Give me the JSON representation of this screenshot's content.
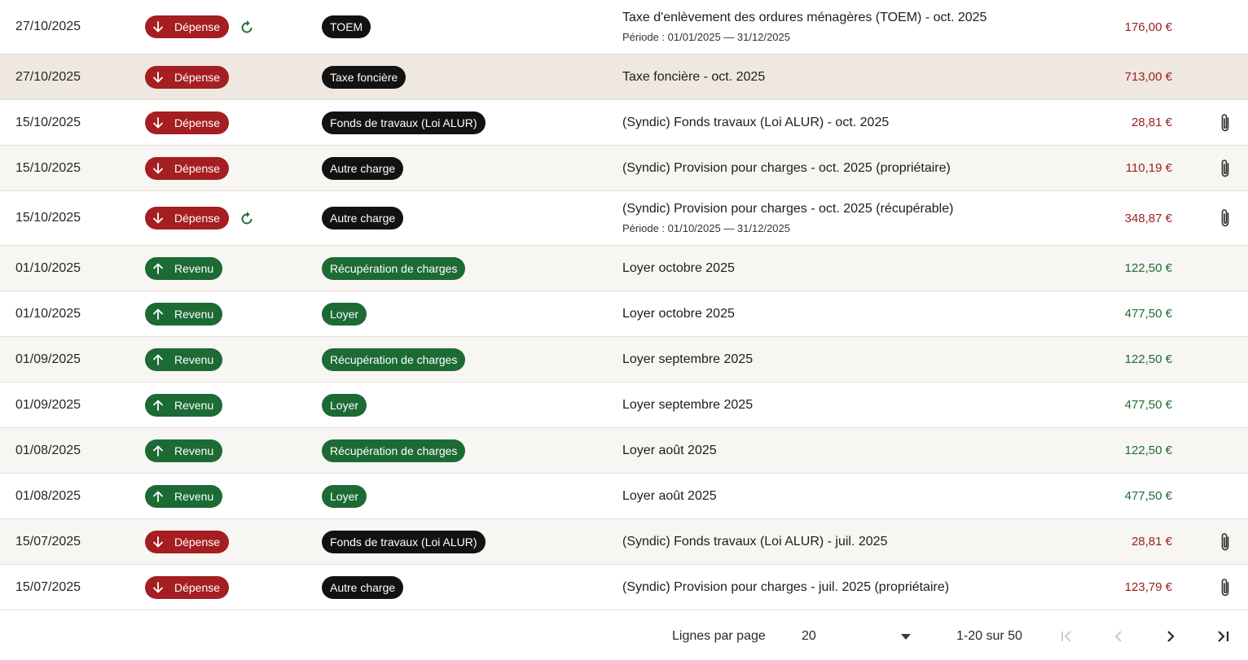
{
  "rows": [
    {
      "date": "27/10/2025",
      "type": "Dépense",
      "recurring": true,
      "category": "TOEM",
      "desc": "Taxe d'enlèvement des ordures ménagères (TOEM) - oct. 2025",
      "period": "Période : 01/01/2025 — 31/12/2025",
      "amount": "176,00 €",
      "attachment": false
    },
    {
      "date": "27/10/2025",
      "type": "Dépense",
      "recurring": false,
      "category": "Taxe foncière",
      "desc": "Taxe foncière - oct. 2025",
      "period": "",
      "amount": "713,00 €",
      "attachment": false
    },
    {
      "date": "15/10/2025",
      "type": "Dépense",
      "recurring": false,
      "category": "Fonds de travaux (Loi ALUR)",
      "desc": "(Syndic) Fonds travaux (Loi ALUR) - oct. 2025",
      "period": "",
      "amount": "28,81 €",
      "attachment": true
    },
    {
      "date": "15/10/2025",
      "type": "Dépense",
      "recurring": false,
      "category": "Autre charge",
      "desc": "(Syndic) Provision pour charges - oct. 2025 (propriétaire)",
      "period": "",
      "amount": "110,19 €",
      "attachment": true
    },
    {
      "date": "15/10/2025",
      "type": "Dépense",
      "recurring": true,
      "category": "Autre charge",
      "desc": "(Syndic) Provision pour charges - oct. 2025 (récupérable)",
      "period": "Période : 01/10/2025 — 31/12/2025",
      "amount": "348,87 €",
      "attachment": true
    },
    {
      "date": "01/10/2025",
      "type": "Revenu",
      "recurring": false,
      "category": "Récupération de charges",
      "desc": "Loyer octobre 2025",
      "period": "",
      "amount": "122,50 €",
      "attachment": false
    },
    {
      "date": "01/10/2025",
      "type": "Revenu",
      "recurring": false,
      "category": "Loyer",
      "desc": "Loyer octobre 2025",
      "period": "",
      "amount": "477,50 €",
      "attachment": false
    },
    {
      "date": "01/09/2025",
      "type": "Revenu",
      "recurring": false,
      "category": "Récupération de charges",
      "desc": "Loyer septembre 2025",
      "period": "",
      "amount": "122,50 €",
      "attachment": false
    },
    {
      "date": "01/09/2025",
      "type": "Revenu",
      "recurring": false,
      "category": "Loyer",
      "desc": "Loyer septembre 2025",
      "period": "",
      "amount": "477,50 €",
      "attachment": false
    },
    {
      "date": "01/08/2025",
      "type": "Revenu",
      "recurring": false,
      "category": "Récupération de charges",
      "desc": "Loyer août 2025",
      "period": "",
      "amount": "122,50 €",
      "attachment": false
    },
    {
      "date": "01/08/2025",
      "type": "Revenu",
      "recurring": false,
      "category": "Loyer",
      "desc": "Loyer août 2025",
      "period": "",
      "amount": "477,50 €",
      "attachment": false
    },
    {
      "date": "15/07/2025",
      "type": "Dépense",
      "recurring": false,
      "category": "Fonds de travaux (Loi ALUR)",
      "desc": "(Syndic) Fonds travaux (Loi ALUR) - juil. 2025",
      "period": "",
      "amount": "28,81 €",
      "attachment": true
    },
    {
      "date": "15/07/2025",
      "type": "Dépense",
      "recurring": false,
      "category": "Autre charge",
      "desc": "(Syndic) Provision pour charges - juil. 2025 (propriétaire)",
      "period": "",
      "amount": "123,79 €",
      "attachment": true
    }
  ],
  "highlighted_row": 1,
  "colors": {
    "expense": "#a41e22",
    "income": "#1c6b35",
    "expense_amount": "#9c1d1d",
    "income_amount": "#1f6b34",
    "category_black": "#121212",
    "recurring_icon": "#1f6b34"
  },
  "icons": {
    "expense": "arrow-down-icon",
    "income": "arrow-up-icon",
    "recurring": "refresh-icon",
    "attachment": "paperclip-icon"
  },
  "footer": {
    "rows_per_page_label": "Lignes par page",
    "rows_per_page_value": "20",
    "range": "1-20 sur 50"
  }
}
